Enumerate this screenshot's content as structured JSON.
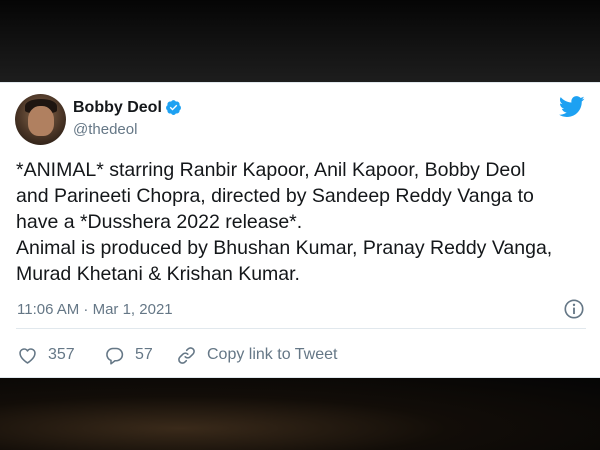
{
  "tweet": {
    "author": {
      "name": "Bobby Deol",
      "handle": "@thedeol",
      "verified": true
    },
    "text_lines": [
      "*ANIMAL* starring Ranbir Kapoor, Anil Kapoor, Bobby Deol",
      "and Parineeti Chopra, directed by Sandeep Reddy Vanga to",
      "have a *Dusshera 2022 release*.",
      "Animal is produced by Bhushan Kumar, Pranay Reddy Vanga,",
      "Murad Khetani & Krishan Kumar."
    ],
    "timestamp": "11:06 AM · Mar 1, 2021",
    "actions": {
      "likes": "357",
      "replies": "57",
      "copy_link_label": "Copy link to Tweet"
    }
  },
  "colors": {
    "twitter_blue": "#1da1f2",
    "text_primary": "#14171a",
    "text_secondary": "#657786"
  },
  "icons": [
    "verified-badge-icon",
    "twitter-bird-icon",
    "info-icon",
    "heart-icon",
    "reply-icon",
    "link-icon"
  ]
}
